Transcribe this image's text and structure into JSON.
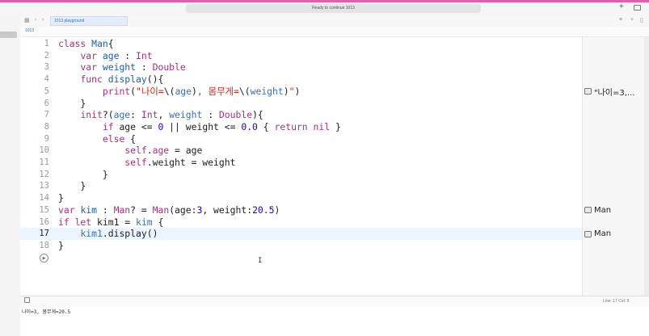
{
  "window": {
    "status": "Ready to continue 1013",
    "plus_icon": "plus-icon"
  },
  "tab": {
    "label": "1013.playground",
    "jump": "1013"
  },
  "editor": {
    "line_numbers": [
      "1",
      "2",
      "3",
      "4",
      "5",
      "6",
      "7",
      "8",
      "9",
      "10",
      "11",
      "12",
      "13",
      "14",
      "15",
      "16",
      "17",
      "18"
    ],
    "current_line": 17
  },
  "results": {
    "line5": "\"나이=3,...",
    "line15": "Man",
    "line17": "Man"
  },
  "debug": {
    "cursor_position": "Line: 17  Col: 9"
  },
  "console": {
    "output": "나이=3, 몸무게=20.5"
  }
}
